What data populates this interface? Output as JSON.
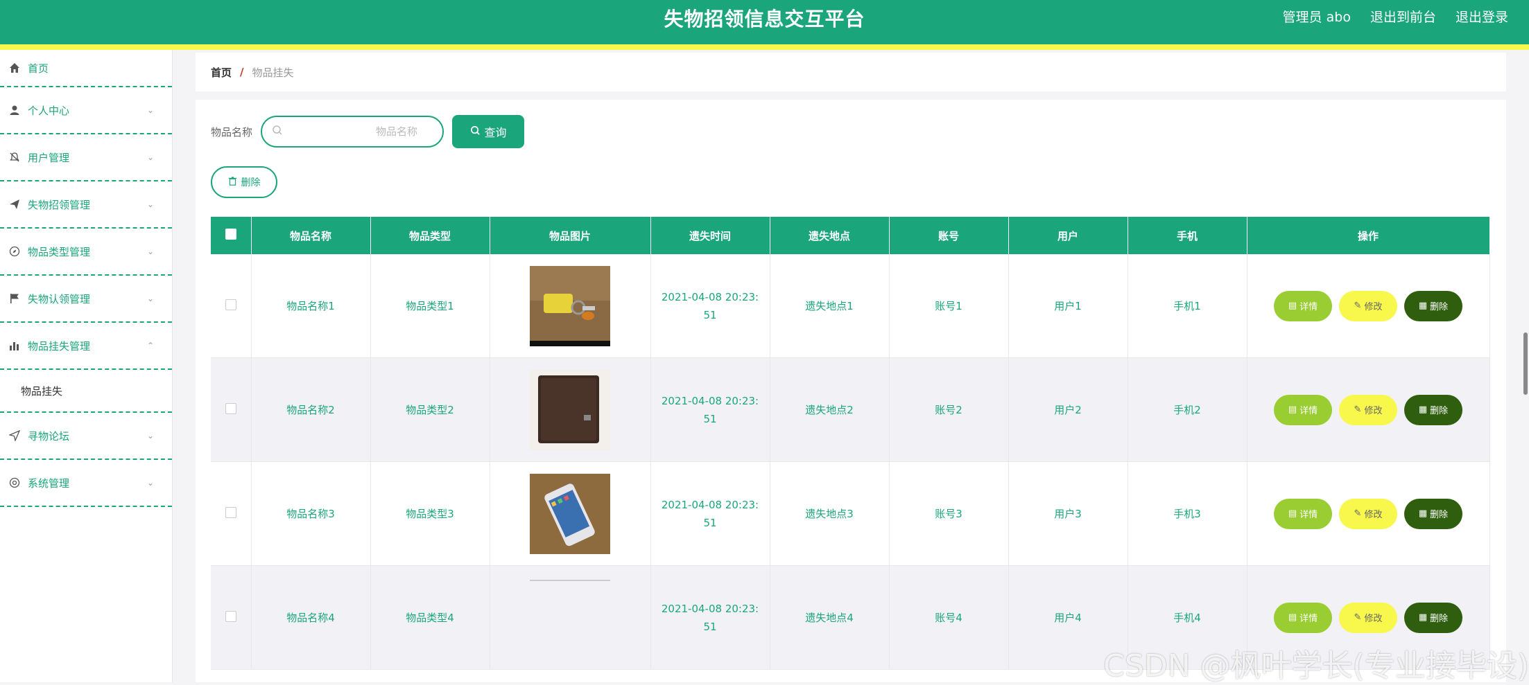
{
  "header": {
    "title": "失物招领信息交互平台",
    "admin_label": "管理员 abo",
    "front_label": "退出到前台",
    "logout_label": "退出登录"
  },
  "sidebar": {
    "items": [
      {
        "label": "首页",
        "icon": "home-icon"
      },
      {
        "label": "个人中心",
        "icon": "user-icon"
      },
      {
        "label": "用户管理",
        "icon": "bell-off-icon"
      },
      {
        "label": "失物招领管理",
        "icon": "send-icon"
      },
      {
        "label": "物品类型管理",
        "icon": "compass-icon"
      },
      {
        "label": "失物认领管理",
        "icon": "flag-icon"
      },
      {
        "label": "物品挂失管理",
        "icon": "bar-chart-icon"
      },
      {
        "label": "寻物论坛",
        "icon": "navigation-icon"
      },
      {
        "label": "系统管理",
        "icon": "settings-icon"
      }
    ],
    "sub_item": "物品挂失"
  },
  "breadcrumb": {
    "home": "首页",
    "separator": "/",
    "current": "物品挂失"
  },
  "search": {
    "label": "物品名称",
    "placeholder": "物品名称",
    "button": "查询"
  },
  "delete_button": "删除",
  "table": {
    "headers": [
      "物品名称",
      "物品类型",
      "物品图片",
      "遗失时间",
      "遗失地点",
      "账号",
      "用户",
      "手机",
      "操作"
    ],
    "rows": [
      {
        "name": "物品名称1",
        "type": "物品类型1",
        "time_line1": "2021-04-08 20:23:",
        "time_line2": "51",
        "place": "遗失地点1",
        "account": "账号1",
        "user": "用户1",
        "phone": "手机1"
      },
      {
        "name": "物品名称2",
        "type": "物品类型2",
        "time_line1": "2021-04-08 20:23:",
        "time_line2": "51",
        "place": "遗失地点2",
        "account": "账号2",
        "user": "用户2",
        "phone": "手机2"
      },
      {
        "name": "物品名称3",
        "type": "物品类型3",
        "time_line1": "2021-04-08 20:23:",
        "time_line2": "51",
        "place": "遗失地点3",
        "account": "账号3",
        "user": "用户3",
        "phone": "手机3"
      },
      {
        "name": "物品名称4",
        "type": "物品类型4",
        "time_line1": "2021-04-08 20:23:",
        "time_line2": "51",
        "place": "遗失地点4",
        "account": "账号4",
        "user": "用户4",
        "phone": "手机4"
      }
    ],
    "actions": {
      "detail": "详情",
      "edit": "修改",
      "delete": "删除"
    }
  },
  "watermark": "CSDN @枫叶学长(专业接毕设)",
  "colors": {
    "primary": "#1aa67a",
    "accent_yellow": "#f7f74c",
    "detail_green": "#9acd32",
    "delete_dark": "#2e5e0e"
  }
}
